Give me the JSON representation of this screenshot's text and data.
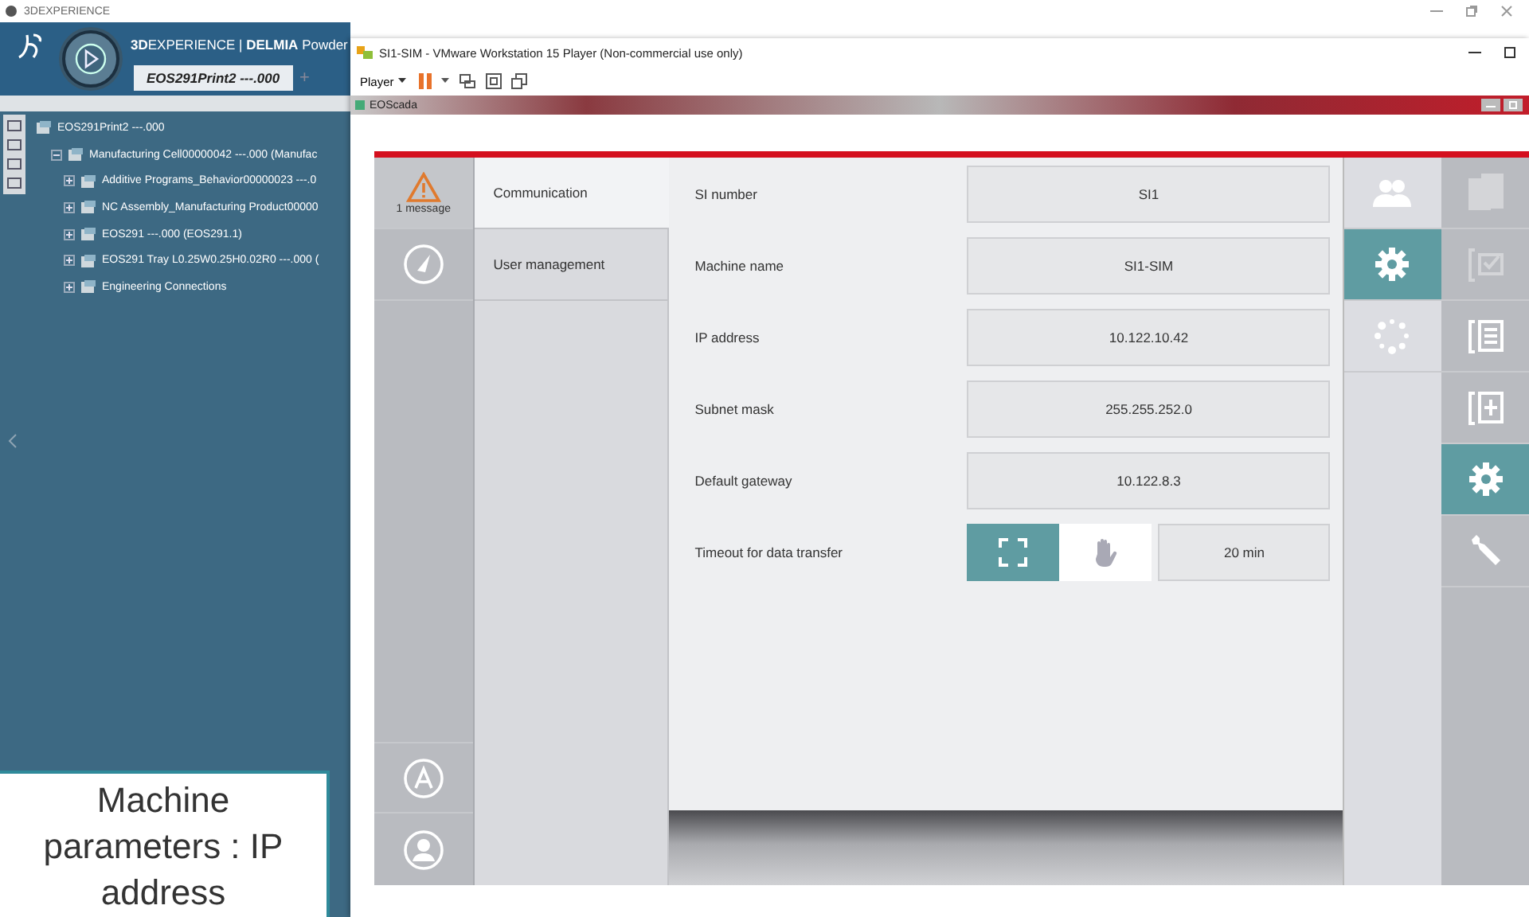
{
  "desktop_title": "3DEXPERIENCE",
  "app": {
    "brand": "**3D**EXPERIENCE | **DELMIA** Powder",
    "tabs": [
      {
        "label": "EOS291Print2 ---.000",
        "selected": true
      }
    ],
    "add_tab": "+",
    "tree": [
      {
        "label": "EOS291Print2 ---.000",
        "children": [
          {
            "label": "Manufacturing Cell00000042 ---.000 (Manufac",
            "expanded": true,
            "children": [
              {
                "label": "Additive Programs_Behavior00000023 ---.0",
                "expanded": false
              },
              {
                "label": "NC Assembly_Manufacturing Product00000",
                "expanded": false
              },
              {
                "label": "EOS291 ---.000 (EOS291.1)",
                "expanded": false
              },
              {
                "label": "EOS291 Tray L0.25W0.25H0.02R0 ---.000 (",
                "expanded": false
              },
              {
                "label": "Engineering Connections",
                "expanded": false
              }
            ]
          }
        ]
      }
    ]
  },
  "caption": "Machine parameters : IP address",
  "vm": {
    "title": "SI1-SIM - VMware Workstation 15 Player (Non-commercial use only)",
    "menu": "Player",
    "subwindow": "EOScada"
  },
  "eoscada": {
    "alarm": {
      "label": "1 message"
    },
    "nav": [
      {
        "label": "Communication",
        "selected": true
      },
      {
        "label": "User management",
        "selected": false
      }
    ],
    "fields": [
      {
        "kind": "text",
        "label": "SI number",
        "value": "SI1"
      },
      {
        "kind": "text",
        "label": "Machine name",
        "value": "SI1-SIM"
      },
      {
        "kind": "text",
        "label": "IP address",
        "value": "10.122.10.42"
      },
      {
        "kind": "text",
        "label": "Subnet mask",
        "value": "255.255.252.0"
      },
      {
        "kind": "text",
        "label": "Default gateway",
        "value": "10.122.8.3"
      },
      {
        "kind": "timeout",
        "label": "Timeout for data transfer",
        "modes": [
          {
            "selected": true
          },
          {
            "selected": false
          }
        ],
        "value": "20 min"
      }
    ],
    "side_tabs": [
      {
        "selected": false
      },
      {
        "selected": true
      },
      {
        "selected": false
      }
    ],
    "main_tabs": [
      {
        "selected": false
      },
      {
        "selected": false
      },
      {
        "selected": false
      },
      {
        "selected": false
      },
      {
        "selected": true
      },
      {
        "selected": false
      }
    ]
  }
}
